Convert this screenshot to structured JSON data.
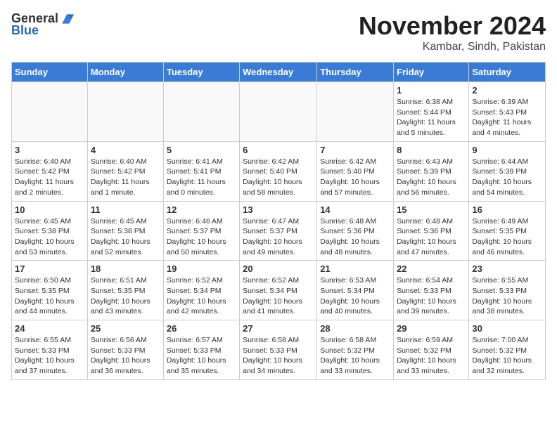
{
  "logo": {
    "general": "General",
    "blue": "Blue"
  },
  "title": {
    "month": "November 2024",
    "location": "Kambar, Sindh, Pakistan"
  },
  "headers": [
    "Sunday",
    "Monday",
    "Tuesday",
    "Wednesday",
    "Thursday",
    "Friday",
    "Saturday"
  ],
  "weeks": [
    [
      {
        "day": "",
        "info": ""
      },
      {
        "day": "",
        "info": ""
      },
      {
        "day": "",
        "info": ""
      },
      {
        "day": "",
        "info": ""
      },
      {
        "day": "",
        "info": ""
      },
      {
        "day": "1",
        "info": "Sunrise: 6:38 AM\nSunset: 5:44 PM\nDaylight: 11 hours and 5 minutes."
      },
      {
        "day": "2",
        "info": "Sunrise: 6:39 AM\nSunset: 5:43 PM\nDaylight: 11 hours and 4 minutes."
      }
    ],
    [
      {
        "day": "3",
        "info": "Sunrise: 6:40 AM\nSunset: 5:42 PM\nDaylight: 11 hours and 2 minutes."
      },
      {
        "day": "4",
        "info": "Sunrise: 6:40 AM\nSunset: 5:42 PM\nDaylight: 11 hours and 1 minute."
      },
      {
        "day": "5",
        "info": "Sunrise: 6:41 AM\nSunset: 5:41 PM\nDaylight: 11 hours and 0 minutes."
      },
      {
        "day": "6",
        "info": "Sunrise: 6:42 AM\nSunset: 5:40 PM\nDaylight: 10 hours and 58 minutes."
      },
      {
        "day": "7",
        "info": "Sunrise: 6:42 AM\nSunset: 5:40 PM\nDaylight: 10 hours and 57 minutes."
      },
      {
        "day": "8",
        "info": "Sunrise: 6:43 AM\nSunset: 5:39 PM\nDaylight: 10 hours and 56 minutes."
      },
      {
        "day": "9",
        "info": "Sunrise: 6:44 AM\nSunset: 5:39 PM\nDaylight: 10 hours and 54 minutes."
      }
    ],
    [
      {
        "day": "10",
        "info": "Sunrise: 6:45 AM\nSunset: 5:38 PM\nDaylight: 10 hours and 53 minutes."
      },
      {
        "day": "11",
        "info": "Sunrise: 6:45 AM\nSunset: 5:38 PM\nDaylight: 10 hours and 52 minutes."
      },
      {
        "day": "12",
        "info": "Sunrise: 6:46 AM\nSunset: 5:37 PM\nDaylight: 10 hours and 50 minutes."
      },
      {
        "day": "13",
        "info": "Sunrise: 6:47 AM\nSunset: 5:37 PM\nDaylight: 10 hours and 49 minutes."
      },
      {
        "day": "14",
        "info": "Sunrise: 6:48 AM\nSunset: 5:36 PM\nDaylight: 10 hours and 48 minutes."
      },
      {
        "day": "15",
        "info": "Sunrise: 6:48 AM\nSunset: 5:36 PM\nDaylight: 10 hours and 47 minutes."
      },
      {
        "day": "16",
        "info": "Sunrise: 6:49 AM\nSunset: 5:35 PM\nDaylight: 10 hours and 46 minutes."
      }
    ],
    [
      {
        "day": "17",
        "info": "Sunrise: 6:50 AM\nSunset: 5:35 PM\nDaylight: 10 hours and 44 minutes."
      },
      {
        "day": "18",
        "info": "Sunrise: 6:51 AM\nSunset: 5:35 PM\nDaylight: 10 hours and 43 minutes."
      },
      {
        "day": "19",
        "info": "Sunrise: 6:52 AM\nSunset: 5:34 PM\nDaylight: 10 hours and 42 minutes."
      },
      {
        "day": "20",
        "info": "Sunrise: 6:52 AM\nSunset: 5:34 PM\nDaylight: 10 hours and 41 minutes."
      },
      {
        "day": "21",
        "info": "Sunrise: 6:53 AM\nSunset: 5:34 PM\nDaylight: 10 hours and 40 minutes."
      },
      {
        "day": "22",
        "info": "Sunrise: 6:54 AM\nSunset: 5:33 PM\nDaylight: 10 hours and 39 minutes."
      },
      {
        "day": "23",
        "info": "Sunrise: 6:55 AM\nSunset: 5:33 PM\nDaylight: 10 hours and 38 minutes."
      }
    ],
    [
      {
        "day": "24",
        "info": "Sunrise: 6:55 AM\nSunset: 5:33 PM\nDaylight: 10 hours and 37 minutes."
      },
      {
        "day": "25",
        "info": "Sunrise: 6:56 AM\nSunset: 5:33 PM\nDaylight: 10 hours and 36 minutes."
      },
      {
        "day": "26",
        "info": "Sunrise: 6:57 AM\nSunset: 5:33 PM\nDaylight: 10 hours and 35 minutes."
      },
      {
        "day": "27",
        "info": "Sunrise: 6:58 AM\nSunset: 5:33 PM\nDaylight: 10 hours and 34 minutes."
      },
      {
        "day": "28",
        "info": "Sunrise: 6:58 AM\nSunset: 5:32 PM\nDaylight: 10 hours and 33 minutes."
      },
      {
        "day": "29",
        "info": "Sunrise: 6:59 AM\nSunset: 5:32 PM\nDaylight: 10 hours and 33 minutes."
      },
      {
        "day": "30",
        "info": "Sunrise: 7:00 AM\nSunset: 5:32 PM\nDaylight: 10 hours and 32 minutes."
      }
    ]
  ]
}
